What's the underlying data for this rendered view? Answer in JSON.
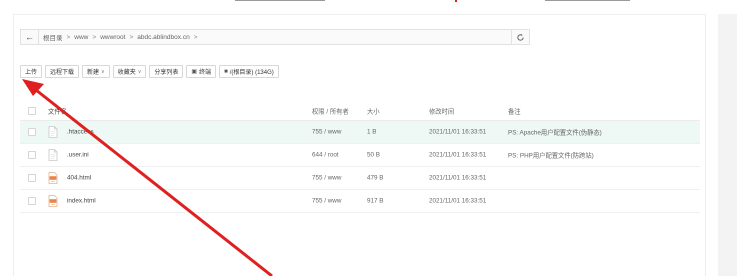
{
  "colors": {
    "accent": "#e02020",
    "row_highlight": "#eef8f5",
    "panel_bg": "#f3f3f3"
  },
  "path_bar": {
    "back_icon": "arrow-left-icon",
    "crumbs": [
      "根目录",
      ">",
      "www",
      ">",
      "wwwroot",
      ">",
      "abdc.ablindbox.cn",
      ">"
    ],
    "refresh_icon": "refresh-icon"
  },
  "toolbar": {
    "upload": "上传",
    "remote_download": "远程下载",
    "new": "新建",
    "favorites": "收藏夹",
    "share_list": "分享列表",
    "terminal": "终端",
    "disk": "/(根目录) (134G)"
  },
  "table": {
    "headers": {
      "name": "文件名",
      "perm": "权限 / 所有者",
      "size": "大小",
      "mtime": "修改时间",
      "note": "备注"
    },
    "rows": [
      {
        "name": ".htaccess",
        "perm": "755 / www",
        "size": "1 B",
        "mtime": "2021/11/01 16:33:51",
        "note": "PS: Apache用户配置文件(伪静态)",
        "icon": "file-icon"
      },
      {
        "name": ".user.ini",
        "perm": "644 / root",
        "size": "50 B",
        "mtime": "2021/11/01 16:33:51",
        "note": "PS: PHP用户配置文件(防跨站)",
        "icon": "file-icon"
      },
      {
        "name": "404.html",
        "perm": "755 / www",
        "size": "479 B",
        "mtime": "2021/11/01 16:33:51",
        "note": "",
        "icon": "html-file-icon"
      },
      {
        "name": "index.html",
        "perm": "755 / www",
        "size": "917 B",
        "mtime": "2021/11/01 16:33:51",
        "note": "",
        "icon": "html-file-icon"
      }
    ]
  }
}
